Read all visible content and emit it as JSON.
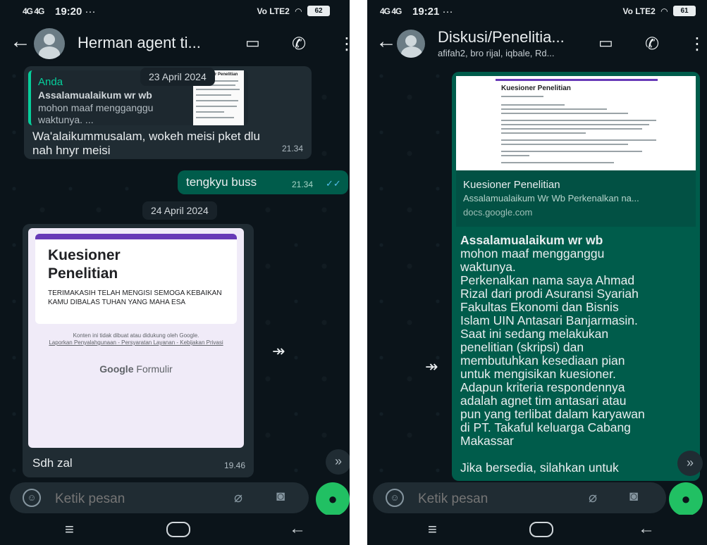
{
  "left": {
    "status": {
      "signal": "4G 4G",
      "time": "19:20",
      "dots": "···",
      "battery": "62",
      "lte": "Vo LTE2"
    },
    "header": {
      "title": "Herman agent ti..."
    },
    "messages": {
      "date1": "23 April 2024",
      "quote_author": "Anda",
      "quote_title": "Assalamualaikum wr wb",
      "quote_text": "mohon maaf mengganggu waktunya. ...",
      "thumb_title": "Kuesioner Penelitian",
      "reply_text": "Wa'alaikummusalam, wokeh meisi pket dlu nah hnyr meisi",
      "reply_time": "21.34",
      "out_text": "tengkyu buss",
      "out_time": "21.34",
      "date2": "24 April 2024",
      "form_title": "Kuesioner Penelitian",
      "form_desc": "TERIMAKASIH TELAH MENGISI SEMOGA KEBAIKAN KAMU DIBALAS TUHAN YANG MAHA ESA",
      "form_note": "Konten ini tidak dibuat atau didukung oleh Google.",
      "form_links": "Laporkan Penyalahgunaan - Persyaratan Layanan - Kebijakan Privasi",
      "form_brand_google": "Google",
      "form_brand_product": "Formulir",
      "caption": "Sdh zal",
      "caption_time": "19.46"
    },
    "input": {
      "placeholder": "Ketik pesan"
    }
  },
  "right": {
    "status": {
      "signal": "4G 4G",
      "time": "19:21",
      "dots": "···",
      "battery": "61",
      "lte": "Vo LTE2"
    },
    "header": {
      "title": "Diskusi/Penelitia...",
      "subtitle": "afifah2, bro rijal, iqbale, Rd..."
    },
    "link": {
      "preview_title": "Kuesioner Penelitian",
      "title": "Kuesioner Penelitian",
      "description": "Assalamualaikum Wr Wb Perkenalkan na...",
      "url": "docs.google.com"
    },
    "message": {
      "greeting": "Assalamualaikum wr wb",
      "l1": "mohon maaf mengganggu",
      "l2": "waktunya.",
      "l3": "Perkenalkan nama saya Ahmad",
      "l4": "Rizal dari prodi Asuransi Syariah",
      "l5": "Fakultas Ekonomi dan Bisnis",
      "l6": "Islam UIN Antasari Banjarmasin.",
      "l7": "Saat ini sedang melakukan",
      "l8": "penelitian (skripsi) dan",
      "l9": "membutuhkan kesediaan pian",
      "l10": "untuk mengisikan kuesioner.",
      "l11": "Adapun kriteria respondennya",
      "l12": "adalah agnet tim antasari atau",
      "l13": "pun yang terlibat dalam karyawan",
      "l14": "di PT. Takaful keluarga Cabang",
      "l15": "Makassar",
      "l16": "Jika bersedia, silahkan untuk"
    },
    "input": {
      "placeholder": "Ketik pesan"
    }
  },
  "icons": {
    "back": "←",
    "video": "▭",
    "call": "✆",
    "menu": "⋮",
    "forward": "↠",
    "chevrons": "»",
    "emoji": "☺",
    "clip": "⌀",
    "camera": "◙",
    "mic": "●",
    "nav_menu": "≡",
    "nav_back": "←",
    "ticks": "✓✓"
  },
  "colors": {
    "bg": "#0b141a",
    "incoming": "#202c33",
    "outgoing": "#005c4b",
    "accent": "#21c063",
    "quote": "#06cf9c"
  }
}
